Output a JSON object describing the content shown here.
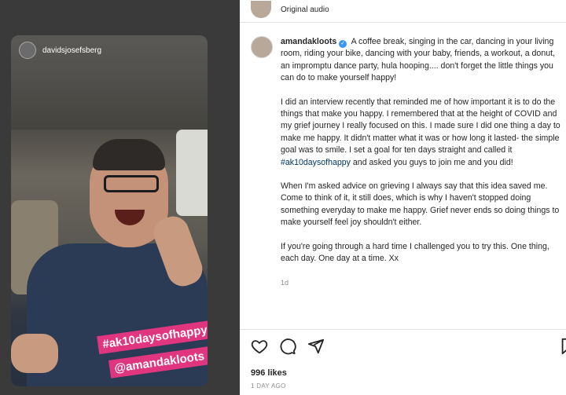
{
  "story": {
    "username": "davidsjosefsberg",
    "tags": [
      "#ak10daysofhappy",
      "@amandakloots"
    ]
  },
  "post": {
    "audio_label": "Original audio",
    "author": "amandakloots",
    "caption_paragraphs": [
      "A coffee break, singing in the car, dancing in your living room, riding your bike, dancing with your baby, friends, a workout, a donut, an impromptu dance party, hula hooping.... don't forget the little things you can do to make yourself happy!",
      "I did an interview recently that reminded me of how important it is to do the things that make you happy. I remembered that at the height of COVID and my grief journey I really focused on this. I made sure I did one thing a day to make me happy. It didn't matter what it was or how long it lasted- the simple goal was to smile. I set a goal for ten days straight and called it",
      "When I'm asked advice on grieving I always say that this idea saved me. Come to think of it, it still does, which is why I haven't stopped doing something everyday to make me happy. Grief never ends so doing things to make yourself feel joy shouldn't either.",
      "If you're going through a hard time I challenged you to try this. One thing, each day. One day at a time. Xx"
    ],
    "caption_hashtag": "#ak10daysofhappy",
    "caption_after_hashtag": "and asked you guys to join me and you did!",
    "caption_time": "1d",
    "likes": "996 likes",
    "date": "1 DAY AGO"
  },
  "icons": {
    "like": "heart-icon",
    "comment": "comment-icon",
    "share": "share-icon",
    "save": "bookmark-icon"
  },
  "colors": {
    "tag_bg": "#e0357f",
    "hashtag": "#00376b",
    "verified": "#3897f0"
  }
}
